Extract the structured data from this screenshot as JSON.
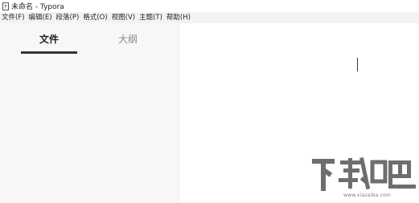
{
  "titlebar": {
    "title": "未命名 - Typora"
  },
  "menubar": {
    "items": [
      {
        "label": "文件(F)"
      },
      {
        "label": "编辑(E)"
      },
      {
        "label": "段落(P)"
      },
      {
        "label": "格式(O)"
      },
      {
        "label": "视图(V)"
      },
      {
        "label": "主题(T)"
      },
      {
        "label": "帮助(H)"
      }
    ]
  },
  "sidebar": {
    "tabs": [
      {
        "label": "文件",
        "active": true
      },
      {
        "label": "大纲",
        "active": false
      }
    ]
  },
  "watermark": {
    "logo_text": "下载吧",
    "domain": "www.xiazaiba.com"
  },
  "colors": {
    "menubar_bg": "#f3f3f3",
    "sidebar_bg": "#f7f7f7",
    "active_tab_text": "#222222",
    "inactive_tab_text": "#8a8a8a",
    "tab_underline": "#333333"
  }
}
